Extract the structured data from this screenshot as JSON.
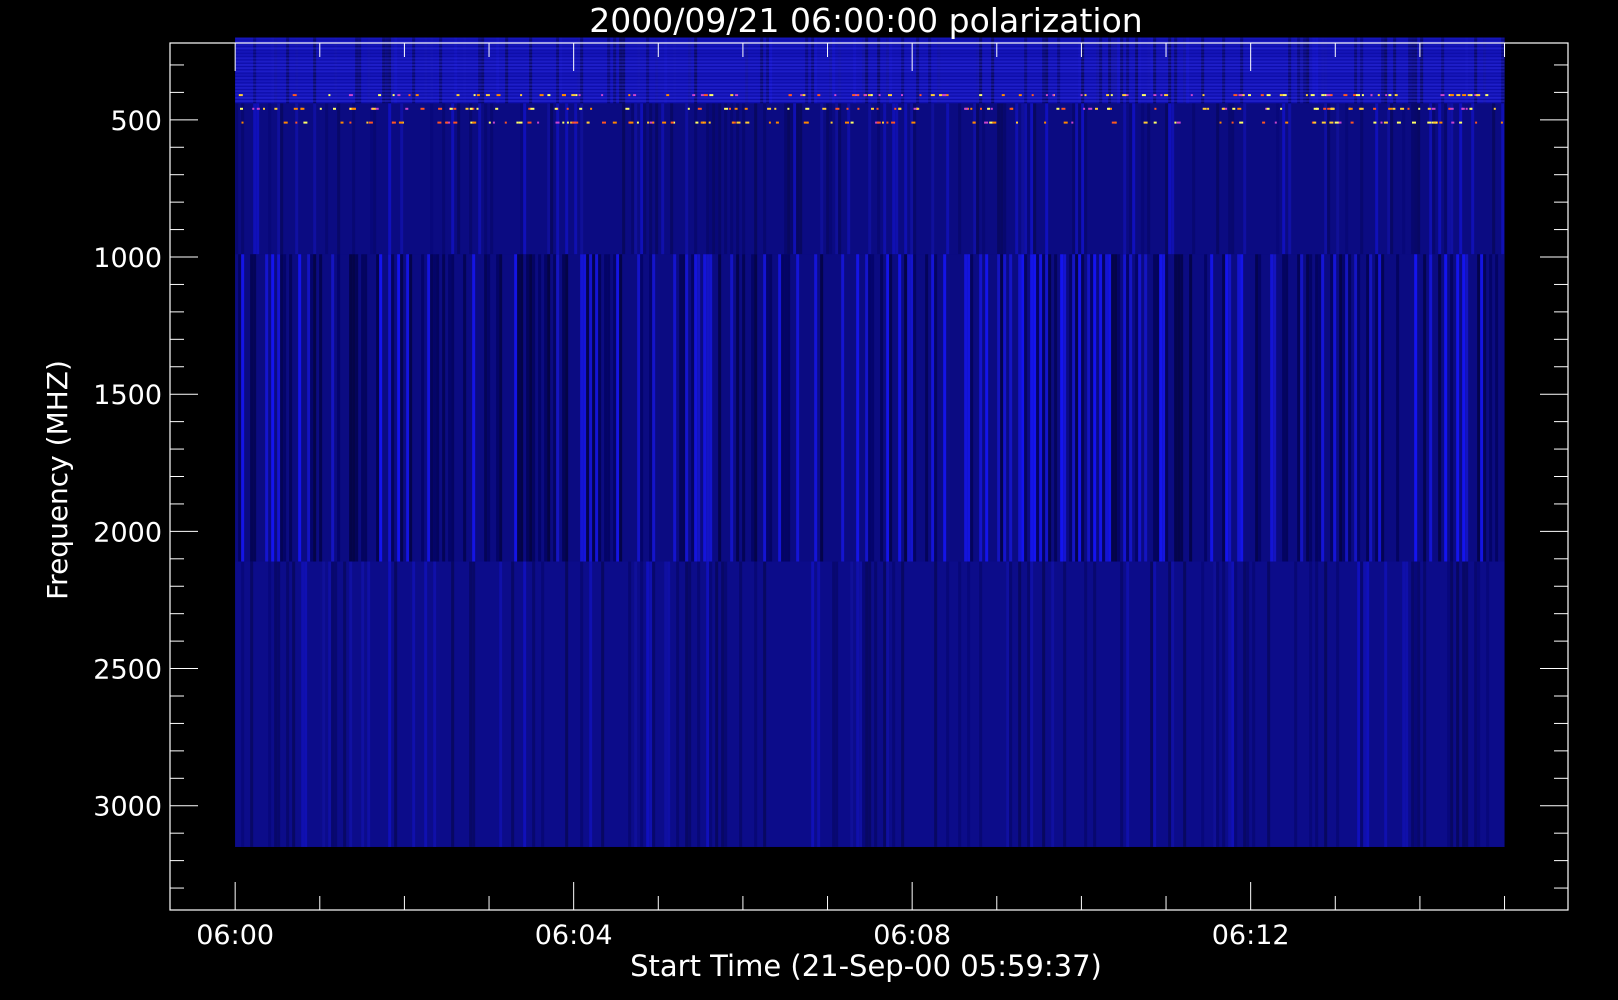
{
  "chart_data": {
    "type": "heatmap",
    "title": "2000/09/21 06:00:00 polarization",
    "xlabel": "Start Time (21-Sep-00 05:59:37)",
    "ylabel": "Frequency (MHZ)",
    "x_tick_labels": [
      "06:00",
      "06:04",
      "06:08",
      "06:12"
    ],
    "x_ticks_minutes": [
      0,
      4,
      8,
      12
    ],
    "x_minor_step_minutes": 1,
    "xlim_minutes": [
      -0.77,
      15.75
    ],
    "data_x_range_minutes": [
      0,
      15
    ],
    "y_tick_labels": [
      "500",
      "1000",
      "1500",
      "2000",
      "2500",
      "3000"
    ],
    "y_ticks": [
      500,
      1000,
      1500,
      2000,
      2500,
      3000
    ],
    "y_minor_step": 100,
    "ylim": [
      3380,
      220
    ],
    "y_inverted": true,
    "data_y_range": [
      3150,
      200
    ],
    "bands": [
      {
        "from": 200,
        "to": 440,
        "level": "brighter",
        "striped": false
      },
      {
        "from": 440,
        "to": 990,
        "level": "medium",
        "striped": false
      },
      {
        "from": 990,
        "to": 2110,
        "level": "medium",
        "striped": true
      },
      {
        "from": 2110,
        "to": 3150,
        "level": "uniform",
        "striped": false
      }
    ],
    "spike_frequencies": [
      410,
      460,
      510
    ],
    "colormap": [
      "#000000",
      "#0a0a6e",
      "#1414c8",
      "#3232ff",
      "#ff8800",
      "#ffff66"
    ],
    "colors": {
      "background": "#000000",
      "axes": "#ffffff",
      "base": "#0c0c86"
    }
  }
}
